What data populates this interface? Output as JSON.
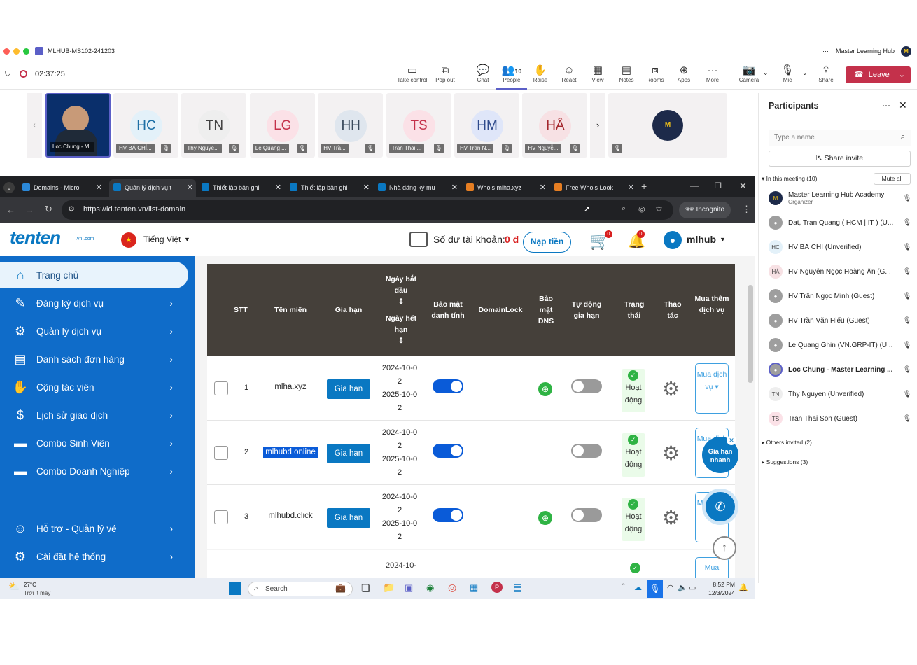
{
  "meeting": {
    "title": "MLHUB-MS102-241203",
    "org": "Master Learning Hub",
    "timer": "02:37:25"
  },
  "toolbar": [
    {
      "label": "Take control",
      "icon": "screen-icon"
    },
    {
      "label": "Pop out",
      "icon": "popout-icon"
    },
    {
      "label": "Chat",
      "icon": "chat-icon"
    },
    {
      "label": "People",
      "icon": "people-icon",
      "count": "10"
    },
    {
      "label": "Raise",
      "icon": "hand-icon"
    },
    {
      "label": "React",
      "icon": "emoji-icon"
    },
    {
      "label": "View",
      "icon": "grid-icon"
    },
    {
      "label": "Notes",
      "icon": "notes-icon"
    },
    {
      "label": "Rooms",
      "icon": "rooms-icon"
    },
    {
      "label": "Apps",
      "icon": "plus-icon"
    },
    {
      "label": "More",
      "icon": "more-icon"
    }
  ],
  "controls": {
    "camera": "Camera",
    "mic": "Mic",
    "share": "Share",
    "leave": "Leave"
  },
  "tiles": [
    {
      "name": "Loc Chung - M..."
    },
    {
      "initials": "HC",
      "name": "HV BÁ CHÍ..."
    },
    {
      "initials": "TN",
      "name": "Thy Nguye..."
    },
    {
      "initials": "LG",
      "name": "Le Quang ..."
    },
    {
      "initials": "HH",
      "name": "HV Trầ..."
    },
    {
      "initials": "TS",
      "name": "Tran Thai ..."
    },
    {
      "initials": "HM",
      "name": "HV Trần N..."
    },
    {
      "initials": "HÂ",
      "name": "HV Nguyễ..."
    }
  ],
  "participants": {
    "title": "Participants",
    "search_placeholder": "Type a name",
    "share_invite": "Share invite",
    "in_meeting": "In this meeting (10)",
    "mute_all": "Mute all",
    "others": "Others invited (2)",
    "suggestions": "Suggestions (3)",
    "list": [
      {
        "initials": "M",
        "name": "Master Learning Hub Academy",
        "sub": "Organizer",
        "color": "#1d2a4a"
      },
      {
        "initials": "",
        "name": "Dat, Tran Quang ( HCM | IT ) (U...",
        "color": "#9e9e9e"
      },
      {
        "initials": "HC",
        "name": "HV BÁ CHÍ (Unverified)",
        "color": "#e3f1f9"
      },
      {
        "initials": "HÂ",
        "name": "HV Nguyễn Ngọc Hoàng Ân (G...",
        "color": "#f7e1e4"
      },
      {
        "initials": "",
        "name": "HV Trần Ngọc Minh (Guest)",
        "color": "#9e9e9e"
      },
      {
        "initials": "",
        "name": "HV Trần Văn Hiếu (Guest)",
        "color": "#9e9e9e"
      },
      {
        "initials": "",
        "name": "Le Quang Ghin (VN.GRP-IT) (U...",
        "color": "#9e9e9e"
      },
      {
        "initials": "",
        "name": "Loc Chung - Master Learning ...",
        "color": "#9e9e9e"
      },
      {
        "initials": "TN",
        "name": "Thy Nguyen (Unverified)",
        "color": "#eeeeee"
      },
      {
        "initials": "TS",
        "name": "Tran Thai Son (Guest)",
        "color": "#fbe1e7"
      }
    ]
  },
  "browser": {
    "tabs": [
      "Domains - Micro",
      "Quản lý dịch vụ t",
      "Thiết lập bản ghi",
      "Thiết lập bản ghi",
      "Nhà đăng ký mu",
      "Whois mlha.xyz",
      "Free Whois Look"
    ],
    "url": "https://id.tenten.vn/list-domain",
    "incognito": "Incognito"
  },
  "site": {
    "lang": "Tiếng Việt",
    "balance_label": "Số dư tài khoản:",
    "balance_value": "0 đ",
    "topup": "Nạp tiền",
    "cart_count": "0",
    "bell_count": "0",
    "user": "mlhub",
    "menu": [
      "Trang chủ",
      "Đăng ký dịch vụ",
      "Quản lý dịch vụ",
      "Danh sách đơn hàng",
      "Cộng tác viên",
      "Lịch sử giao dịch",
      "Combo Sinh Viên",
      "Combo Doanh Nghiệp",
      "Hỗ trợ - Quản lý vé",
      "Cài đặt hệ thống"
    ],
    "headers": {
      "stt": "STT",
      "domain": "Tên miền",
      "renew": "Gia hạn",
      "start": "Ngày bắt đầu",
      "end": "Ngày hết hạn",
      "privacy": "Bảo mật danh tính",
      "lock": "DomainLock",
      "dns": "Bảo mật DNS",
      "auto": "Tự động gia hạn",
      "status": "Trạng thái",
      "action": "Thao tác",
      "buy": "Mua thêm dịch vụ"
    },
    "rows": [
      {
        "stt": "1",
        "domain": "mlha.xyz",
        "start": "2024-10-02",
        "end": "2025-10-02",
        "status": "Hoạt động",
        "renew": "Gia hạn"
      },
      {
        "stt": "2",
        "domain": "mlhubd.online",
        "start": "2024-10-02",
        "end": "2025-10-02",
        "status": "Hoạt động",
        "renew": "Gia hạn"
      },
      {
        "stt": "3",
        "domain": "mlhubd.click",
        "start": "2024-10-02",
        "end": "2025-10-02",
        "status": "Hoạt động",
        "renew": "Gia hạn"
      }
    ],
    "row4_start": "2024-10-",
    "buy_label": "Mua dịch vụ ▾",
    "quick_renew": "Gia hạn nhanh"
  },
  "taskbar": {
    "weather": "27°C",
    "weather_sub": "Trời ít mây",
    "search": "Search",
    "time": "8:52 PM",
    "date": "12/3/2024"
  }
}
